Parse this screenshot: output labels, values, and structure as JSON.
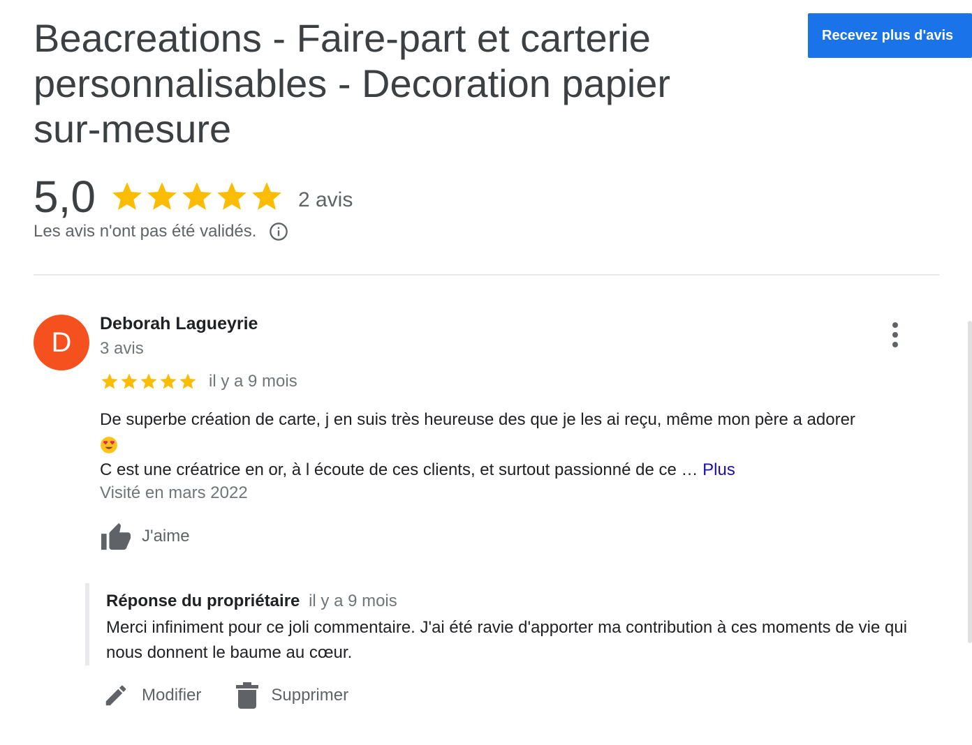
{
  "header": {
    "title": "Beacreations - Faire-part et carterie personnalisables - Decoration papier sur-mesure",
    "cta_label": "Recevez plus d'avis"
  },
  "summary": {
    "score": "5,0",
    "stars": 5,
    "count_label": "2 avis",
    "unverified_note": "Les avis n'ont pas été validés."
  },
  "review": {
    "avatar_letter": "D",
    "avatar_color": "#f4511e",
    "author": "Deborah Lagueyrie",
    "author_reviews": "3 avis",
    "stars": 5,
    "time": "il y a 9 mois",
    "text_line1": "De superbe création de carte, j en suis très heureuse des que je les ai reçu, même mon père a adorer",
    "emoji": "smiling-face-with-heart-eyes",
    "text_line2": "C est une créatrice en or, à l écoute de ces clients, et surtout passionné de ce …",
    "more_label": "Plus",
    "visited": "Visité en mars 2022",
    "like_label": "J'aime"
  },
  "owner_reply": {
    "label": "Réponse du propriétaire",
    "time": "il y a 9 mois",
    "text": "Merci infiniment pour ce joli commentaire. J'ai été ravie d'apporter ma contribution à ces moments de vie qui nous donnent le baume au cœur."
  },
  "actions": {
    "edit_label": "Modifier",
    "delete_label": "Supprimer"
  },
  "colors": {
    "accent": "#1a73e8",
    "star": "#fbbc04",
    "link": "#1a0dab"
  }
}
